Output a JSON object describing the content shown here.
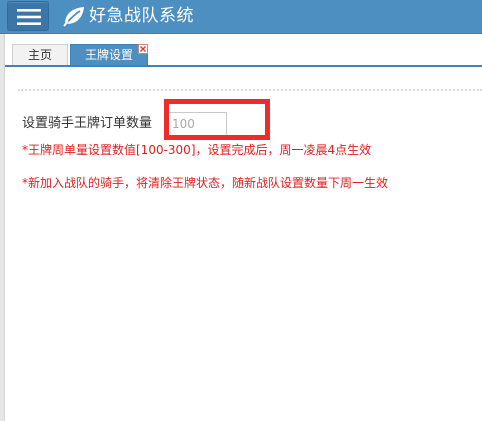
{
  "header": {
    "app_title": "好急战队系统",
    "background": "#4d8fc1",
    "menu_icon": "hamburger-menu-icon",
    "logo_icon": "leaf-logo-icon"
  },
  "tabs": [
    {
      "label": "主页",
      "active": false
    },
    {
      "label": "王牌设置",
      "active": true,
      "close_icon": "close-icon"
    }
  ],
  "form": {
    "label": "设置骑手王牌订单数量",
    "input_value": "",
    "input_placeholder": "100"
  },
  "notes": [
    "*王牌周单量设置数值[100-300]，设置完成后，周一凌晨4点生效",
    "*新加入战队的骑手，将清除王牌状态，随新战队设置数量下周一生效"
  ],
  "colors": {
    "accent": "#4d8fc1",
    "note_text": "#e02020",
    "highlight": "#ee2c2c"
  }
}
